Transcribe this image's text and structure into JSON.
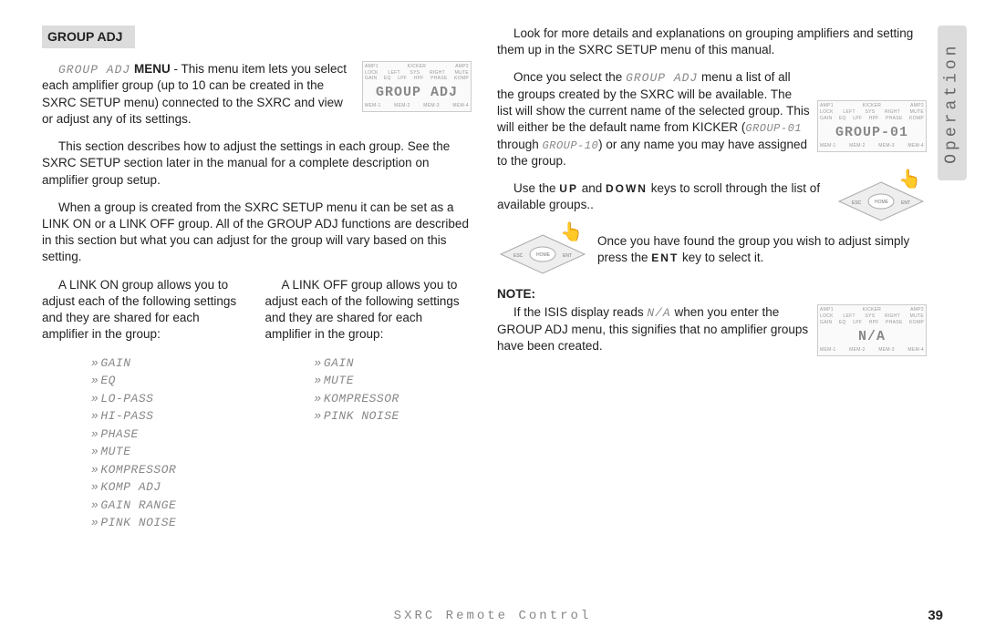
{
  "side_tab": "Operation",
  "section_title": "GROUP ADJ",
  "left": {
    "p1_pre": "GROUP ADJ",
    "p1_bold": " MENU",
    "p1": " - This menu item lets you select each amplifier group (up to 10 can be created in the SXRC SETUP menu) connected to the SXRC and view or adjust any of its settings.",
    "p2": "This section describes how to adjust the settings in each group. See the SXRC SETUP section later in the manual for a complete description on amplifier group setup.",
    "p3": "When a group is created from the SXRC SETUP menu it can be set as a LINK ON or a LINK OFF group. All of the GROUP ADJ functions are described in this section but what you can adjust for the group will vary based on this setting.",
    "linkon_intro": "A LINK ON group allows you to adjust each of the following settings and they are shared for each amplifier in the group:",
    "linkoff_intro": "A LINK OFF group allows you to adjust each of the following settings and they are shared for each amplifier in the group:",
    "linkon_items": [
      "GAIN",
      "EQ",
      "LO-PASS",
      "HI-PASS",
      "PHASE",
      "MUTE",
      "KOMPRESSOR",
      "KOMP  ADJ",
      "GAIN RANGE",
      "PINK NOISE"
    ],
    "linkoff_items": [
      "GAIN",
      "MUTE",
      "KOMPRESSOR",
      "PINK NOISE"
    ]
  },
  "right": {
    "p1": "Look for more details and explanations on grouping amplifiers and setting them up in the SXRC SETUP menu of this manual.",
    "p2a": "Once you select the ",
    "p2_seg": "GROUP ADJ",
    "p2b": " menu a list of all the groups created by the SXRC will be available. The list will show the current name of the selected group. This will either be the default name from KICKER (",
    "p2_seg2": "GROUP-01",
    "p2c": " through ",
    "p2_seg3": "GROUP-10",
    "p2d": ") or any name you may have assigned to the group.",
    "p3a": "Use the ",
    "p3_up": "UP",
    "p3b": " and ",
    "p3_down": "DOWN",
    "p3c": " keys to scroll through the list of available groups..",
    "p4a": "Once you have found the group you wish to adjust simply press the ",
    "p4_ent": "ENT",
    "p4b": " key to select it.",
    "note_head": "NOTE:",
    "note_a": "If the ISIS display reads ",
    "note_seg": "N/A",
    "note_b": " when you enter the GROUP ADJ menu, this signifies that no amplifier groups have been created."
  },
  "lcd1_big": "GROUP ADJ",
  "lcd2_big": "GROUP-01",
  "lcd3_big": "N/A",
  "lcd_top": [
    "AMP1",
    "",
    "KICKER",
    "",
    "AMP2"
  ],
  "lcd_mid": [
    "LOCK",
    "LEFT",
    "SYS",
    "RIGHT",
    "MUTE"
  ],
  "lcd_mid2": [
    "GAIN",
    "EQ",
    "LPF",
    "HPF",
    "PHASE",
    "KOMP"
  ],
  "lcd_bot": [
    "MEM-1",
    "MEM-2",
    "MEM-3",
    "MEM-4"
  ],
  "nav_labels": {
    "esc": "ESC",
    "home": "HOME",
    "ent": "ENT"
  },
  "footer": "SXRC Remote Control",
  "page": "39"
}
